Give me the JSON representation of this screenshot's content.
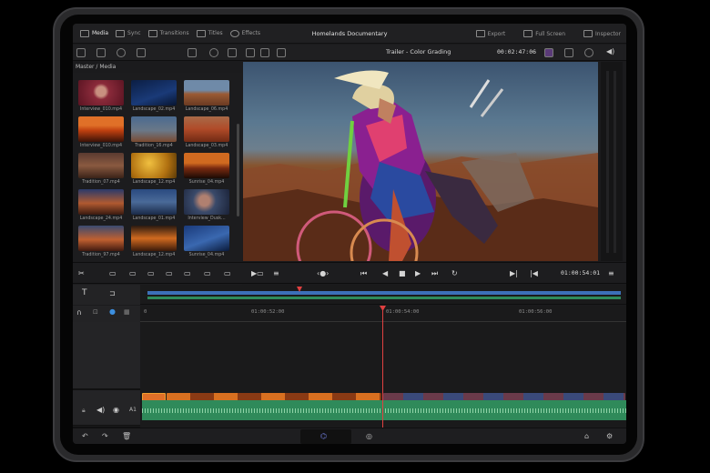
{
  "app": {
    "project_title": "Homelands Documentary",
    "tabs": [
      {
        "label": "Media",
        "icon": "media-icon",
        "active": true
      },
      {
        "label": "Sync",
        "icon": "sync-icon",
        "active": false
      },
      {
        "label": "Transitions",
        "icon": "transitions-icon",
        "active": false
      },
      {
        "label": "Titles",
        "icon": "titles-icon",
        "active": false
      },
      {
        "label": "Effects",
        "icon": "effects-icon",
        "active": false
      }
    ],
    "right_buttons": [
      {
        "label": "Export",
        "icon": "export-icon"
      },
      {
        "label": "Full Screen",
        "icon": "fullscreen-icon"
      },
      {
        "label": "Inspector",
        "icon": "inspector-icon"
      }
    ]
  },
  "viewer": {
    "clip_title": "Trailer - Color Grading",
    "source_timecode": "00:02:47:06",
    "timeline_timecode": "01:00:54:01"
  },
  "media_pool": {
    "breadcrumb": "Master / Media",
    "clips": [
      {
        "name": "Interview_010.mp4",
        "palette": "portrait-red"
      },
      {
        "name": "Landscape_02.mp4",
        "palette": "night-blue"
      },
      {
        "name": "Landscape_06.mp4",
        "palette": "desert-day"
      },
      {
        "name": "Interview_010.mp4",
        "palette": "sunset-orange"
      },
      {
        "name": "Tradition_16.mp4",
        "palette": "dancer-sky"
      },
      {
        "name": "Landscape_03.mp4",
        "palette": "red-rock"
      },
      {
        "name": "Tradition_07.mp4",
        "palette": "dancer-dusk"
      },
      {
        "name": "Landscape_12.mp4",
        "palette": "golden-field"
      },
      {
        "name": "Sunrise_04.mp4",
        "palette": "sunrise-tree"
      },
      {
        "name": "Landscape_24.mp4",
        "palette": "dusk-hills"
      },
      {
        "name": "Landscape_01.mp4",
        "palette": "blue-mesa"
      },
      {
        "name": "Interview_Dusk...",
        "palette": "portrait-dusk"
      },
      {
        "name": "Tradition_97.mp4",
        "palette": "dancer-sunset"
      },
      {
        "name": "Landscape_12.mp4",
        "palette": "orange-horizon"
      },
      {
        "name": "Sunrise_04.mp4",
        "palette": "blue-dawn"
      }
    ]
  },
  "timeline": {
    "ruler_labels": [
      "01:00:52:00",
      "01:00:54:00",
      "01:00:56:00"
    ],
    "tracks": [
      {
        "label": "1",
        "kind": "video"
      },
      {
        "label": "A1",
        "kind": "audio"
      }
    ],
    "ruler_start": "0"
  },
  "colors": {
    "accent": "#e04040",
    "audio": "#2f8a5a",
    "selection": "#f0a030",
    "overview_bar": "#3c6fb8"
  }
}
